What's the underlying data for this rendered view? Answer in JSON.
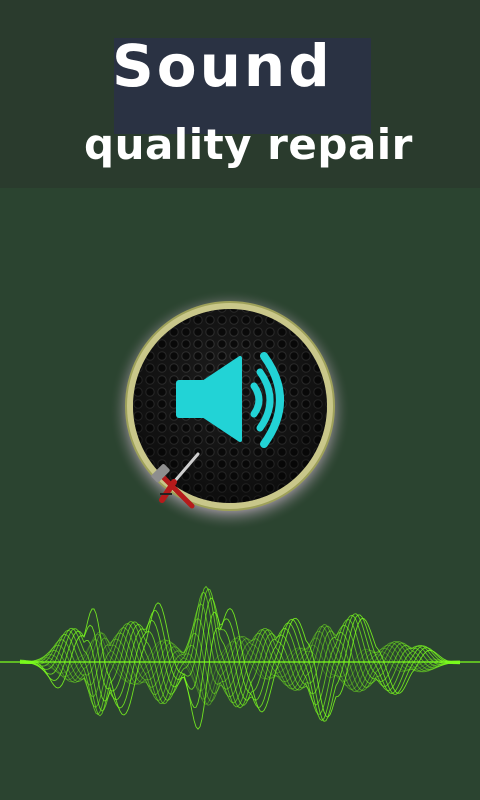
{
  "header": {
    "title": "Sound",
    "subtitle": "quality repair"
  },
  "colors": {
    "background": "#2b4430",
    "header_background": "#2a3b2d",
    "title_box": "#2a3243",
    "accent_cyan": "#22d3d6",
    "wave_green": "#7cff1e",
    "ring": "#b9b86a"
  },
  "icons": {
    "app_icon": "speaker-repair-icon",
    "speaker": "speaker-icon",
    "tools": "hammer-screwdriver-icon",
    "waveform": "sound-waveform"
  }
}
